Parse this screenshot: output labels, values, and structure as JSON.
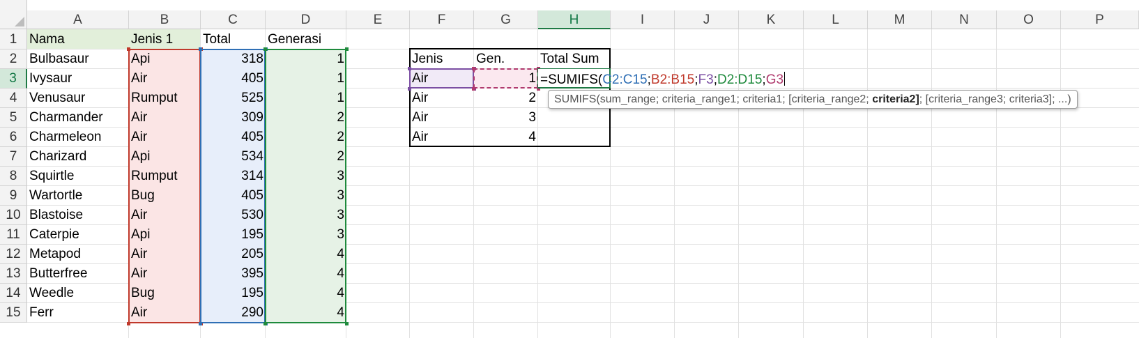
{
  "columns": [
    "A",
    "B",
    "C",
    "D",
    "E",
    "F",
    "G",
    "H",
    "I",
    "J",
    "K",
    "L",
    "M",
    "N",
    "O",
    "P"
  ],
  "rows": [
    "1",
    "2",
    "3",
    "4",
    "5",
    "6",
    "7",
    "8",
    "9",
    "10",
    "11",
    "12",
    "13",
    "14",
    "15"
  ],
  "active_cell": "H3",
  "headers": {
    "nama": "Nama",
    "jenis": "Jenis 1",
    "total": "Total",
    "generasi": "Generasi"
  },
  "data_rows": [
    {
      "nama": "Bulbasaur",
      "jenis": "Api",
      "total": "318",
      "gen": "1"
    },
    {
      "nama": "Ivysaur",
      "jenis": "Air",
      "total": "405",
      "gen": "1"
    },
    {
      "nama": "Venusaur",
      "jenis": "Rumput",
      "total": "525",
      "gen": "1"
    },
    {
      "nama": "Charmander",
      "jenis": "Air",
      "total": "309",
      "gen": "2"
    },
    {
      "nama": "Charmeleon",
      "jenis": "Air",
      "total": "405",
      "gen": "2"
    },
    {
      "nama": "Charizard",
      "jenis": "Api",
      "total": "534",
      "gen": "2"
    },
    {
      "nama": "Squirtle",
      "jenis": "Rumput",
      "total": "314",
      "gen": "3"
    },
    {
      "nama": "Wartortle",
      "jenis": "Bug",
      "total": "405",
      "gen": "3"
    },
    {
      "nama": "Blastoise",
      "jenis": "Air",
      "total": "530",
      "gen": "3"
    },
    {
      "nama": "Caterpie",
      "jenis": "Api",
      "total": "195",
      "gen": "3"
    },
    {
      "nama": "Metapod",
      "jenis": "Air",
      "total": "205",
      "gen": "4"
    },
    {
      "nama": "Butterfree",
      "jenis": "Air",
      "total": "395",
      "gen": "4"
    },
    {
      "nama": "Weedle",
      "jenis": "Bug",
      "total": "195",
      "gen": "4"
    },
    {
      "nama": "Ferr",
      "jenis": "Air",
      "total": "290",
      "gen": "4"
    }
  ],
  "summary": {
    "headers": {
      "jenis": "Jenis",
      "gen": "Gen.",
      "total_sum": "Total Sum"
    },
    "rows": [
      {
        "jenis": "Air",
        "gen": "1"
      },
      {
        "jenis": "Air",
        "gen": "2"
      },
      {
        "jenis": "Air",
        "gen": "3"
      },
      {
        "jenis": "Air",
        "gen": "4"
      }
    ]
  },
  "formula": {
    "prefix": "=SUMIFS(",
    "sep": ";",
    "args": [
      {
        "text": "C2:C15",
        "color": "#2f6fb5"
      },
      {
        "text": "B2:B15",
        "color": "#c0392b"
      },
      {
        "text": "F3",
        "color": "#7b4fa3"
      },
      {
        "text": "D2:D15",
        "color": "#1e8a3c"
      },
      {
        "text": "G3",
        "color": "#b03a6e"
      }
    ]
  },
  "tooltip": {
    "before": "SUMIFS(sum_range; criteria_range1; criteria1; [criteria_range2; ",
    "bold": "criteria2]",
    "after": "; [criteria_range3; criteria3]; ...)"
  },
  "colors": {
    "header_fill": "#e2efda",
    "range_c": "#2f6fb5",
    "range_b": "#c0392b",
    "range_f": "#7b4fa3",
    "range_d": "#1e8a3c",
    "range_g": "#b03a6e",
    "active": "#1e7a45"
  }
}
